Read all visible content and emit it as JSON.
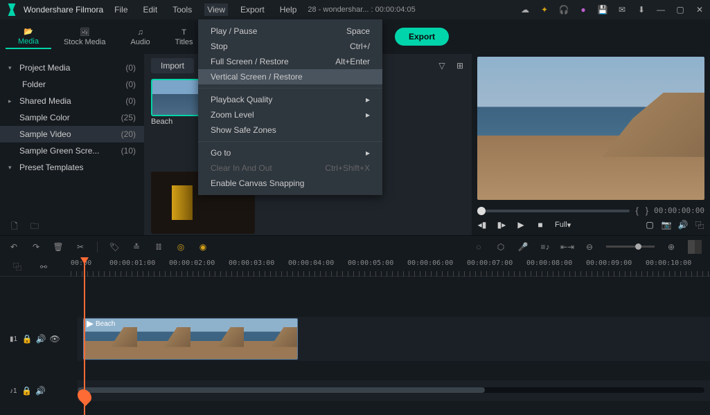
{
  "app": {
    "title": "Wondershare Filmora"
  },
  "menu": [
    "File",
    "Edit",
    "Tools",
    "View",
    "Export",
    "Help"
  ],
  "project_indicator": "28 - wondershar... : 00:00:04:05",
  "tabs": [
    {
      "label": "Media"
    },
    {
      "label": "Stock Media"
    },
    {
      "label": "Audio"
    },
    {
      "label": "Titles"
    }
  ],
  "export_button": "Export",
  "dropdown": {
    "items": [
      {
        "label": "Play / Pause",
        "shortcut": "Space"
      },
      {
        "label": "Stop",
        "shortcut": "Ctrl+/"
      },
      {
        "label": "Full Screen / Restore",
        "shortcut": "Alt+Enter"
      },
      {
        "label": "Vertical Screen / Restore",
        "shortcut": "",
        "hover": true
      },
      {
        "sep": true
      },
      {
        "label": "Playback Quality",
        "submenu": true
      },
      {
        "label": "Zoom Level",
        "submenu": true
      },
      {
        "label": "Show Safe Zones"
      },
      {
        "sep": true
      },
      {
        "label": "Go to",
        "submenu": true
      },
      {
        "label": "Clear In And Out",
        "shortcut": "Ctrl+Shift+X",
        "disabled": true
      },
      {
        "label": "Enable Canvas Snapping"
      }
    ]
  },
  "sidebar": {
    "items": [
      {
        "label": "Project Media",
        "count": "(0)",
        "expander": "▾"
      },
      {
        "label": "Folder",
        "count": "(0)",
        "indent": true
      },
      {
        "label": "Shared Media",
        "count": "(0)",
        "expander": "▸"
      },
      {
        "label": "Sample Color",
        "count": "(25)"
      },
      {
        "label": "Sample Video",
        "count": "(20)",
        "selected": true
      },
      {
        "label": "Sample Green Scre...",
        "count": "(10)"
      },
      {
        "label": "Preset Templates",
        "expander": "▾"
      }
    ]
  },
  "import_button": "Import",
  "media_thumbs": [
    {
      "label": "Beach",
      "active": true
    }
  ],
  "preview": {
    "time": "00:00:00:00",
    "full_label": "Full"
  },
  "timeline": {
    "ticks": [
      "00:00",
      "00:00:01:00",
      "00:00:02:00",
      "00:00:03:00",
      "00:00:04:00",
      "00:00:05:00",
      "00:00:06:00",
      "00:00:07:00",
      "00:00:08:00",
      "00:00:09:00",
      "00:00:10:00"
    ],
    "clip_label": "Beach",
    "video_track": "1",
    "audio_track": "1"
  }
}
